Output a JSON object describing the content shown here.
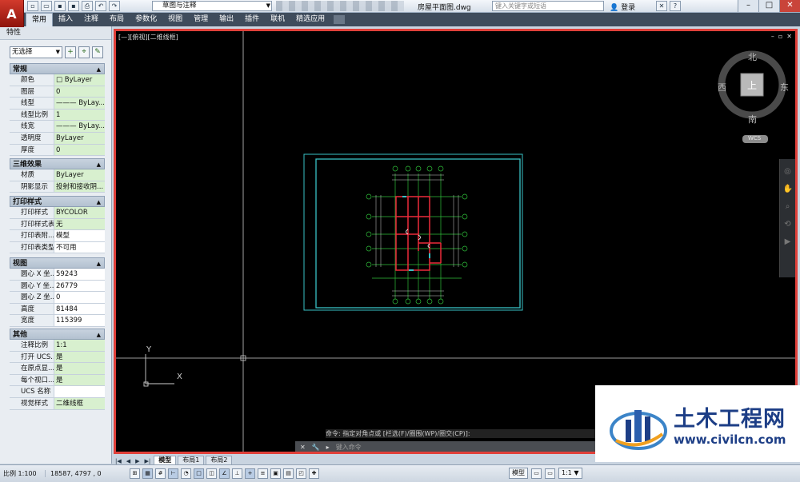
{
  "window": {
    "filename": "房屋平面图.dwg",
    "workspace": "草图与注释",
    "search_placeholder": "键入关键字或短语",
    "login": "登录"
  },
  "ribbon": {
    "tabs": [
      "常用",
      "插入",
      "注释",
      "布局",
      "参数化",
      "视图",
      "管理",
      "输出",
      "插件",
      "联机",
      "精选应用"
    ]
  },
  "palette": {
    "title": "特性",
    "selection": "无选择",
    "sections": [
      {
        "title": "常规",
        "rows": [
          {
            "k": "颜色",
            "v": "□ ByLayer"
          },
          {
            "k": "图层",
            "v": "0"
          },
          {
            "k": "线型",
            "v": "——— ByLay..."
          },
          {
            "k": "线型比例",
            "v": "1"
          },
          {
            "k": "线宽",
            "v": "——— ByLay..."
          },
          {
            "k": "透明度",
            "v": "ByLayer"
          },
          {
            "k": "厚度",
            "v": "0"
          }
        ]
      },
      {
        "title": "三维效果",
        "rows": [
          {
            "k": "材质",
            "v": "ByLayer"
          },
          {
            "k": "阴影显示",
            "v": "投射和接收阴..."
          }
        ]
      },
      {
        "title": "打印样式",
        "rows": [
          {
            "k": "打印样式",
            "v": "BYCOLOR"
          },
          {
            "k": "打印样式表",
            "v": "无"
          },
          {
            "k": "打印表附...",
            "v": "模型"
          },
          {
            "k": "打印表类型",
            "v": "不可用"
          }
        ]
      },
      {
        "title": "视图",
        "rows": [
          {
            "k": "圆心 X 坐...",
            "v": "59243"
          },
          {
            "k": "圆心 Y 坐...",
            "v": "26779"
          },
          {
            "k": "圆心 Z 坐...",
            "v": "0"
          },
          {
            "k": "高度",
            "v": "81484"
          },
          {
            "k": "宽度",
            "v": "115399"
          }
        ]
      },
      {
        "title": "其他",
        "rows": [
          {
            "k": "注释比例",
            "v": "1:1"
          },
          {
            "k": "打开 UCS...",
            "v": "是"
          },
          {
            "k": "在原点显...",
            "v": "是"
          },
          {
            "k": "每个视口...",
            "v": "是"
          },
          {
            "k": "UCS 名称",
            "v": ""
          },
          {
            "k": "视觉样式",
            "v": "二维线框"
          }
        ]
      }
    ]
  },
  "viewport": {
    "label": "[—][俯视][二维线框]",
    "viewcube": {
      "north": "北",
      "south": "南",
      "east": "东",
      "west": "西",
      "face": "上",
      "ucs": "WCS"
    },
    "ucs_x": "X",
    "ucs_y": "Y"
  },
  "command": {
    "history": "命令: 指定对角点或 [栏选(F)/圈围(WP)/圈交(CP)]:",
    "placeholder": "键入命令"
  },
  "layout_tabs": [
    "模型",
    "布局1",
    "布局2"
  ],
  "statusbar": {
    "scale": "比例 1:100",
    "coords": "18587, 4797 , 0",
    "model": "模型",
    "anno_scale": "1:1"
  },
  "watermark": {
    "name": "土木工程网",
    "url": "www.civilcn.com"
  }
}
